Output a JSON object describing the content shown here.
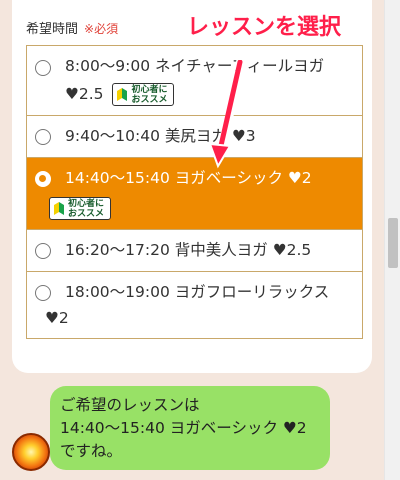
{
  "form": {
    "label": "希望時間",
    "required_mark": "※必須"
  },
  "options": [
    {
      "line1": "8:00〜9:00 ネイチャーフィールヨガ",
      "line2": "♥2.5",
      "badge": "初心者におススメ",
      "selected": false
    },
    {
      "line1": "9:40〜10:40 美尻ヨガ ♥3",
      "selected": false
    },
    {
      "line1": "14:40〜15:40 ヨガベーシック ♥2",
      "badge": "初心者におススメ",
      "selected": true
    },
    {
      "line1": "16:20〜17:20 背中美人ヨガ ♥2.5",
      "selected": false
    },
    {
      "line1": "18:00〜19:00 ヨガフローリラックス",
      "line2": "♥2",
      "selected": false
    }
  ],
  "annotation": {
    "text": "レッスンを選択",
    "color": "#ff1f4a"
  },
  "chat": {
    "line1": "ご希望のレッスンは",
    "line2": "14:40〜15:40 ヨガベーシック ♥2",
    "line3": "ですね。"
  },
  "colors": {
    "selected_row": "#ee8a00",
    "border": "#c9a86a",
    "chat_bubble": "#98e166",
    "background": "#f4e6dd"
  }
}
